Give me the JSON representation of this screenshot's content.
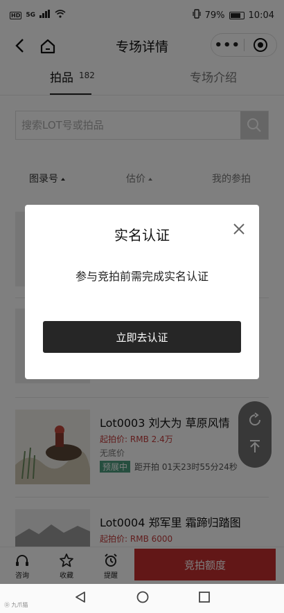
{
  "status_bar": {
    "network_badge": "HD",
    "network_type": "5G",
    "battery_percent": "79%",
    "time": "10:04"
  },
  "nav": {
    "title": "专场详情",
    "more_glyph": "•••"
  },
  "tabs": {
    "lots_label": "拍品",
    "lots_count": "182",
    "intro_label": "专场介绍"
  },
  "search": {
    "placeholder": "搜索LOT号或拍品"
  },
  "sort": {
    "catalog_label": "图录号",
    "estimate_label": "估价",
    "my_bids_label": "我的参拍"
  },
  "lots": [
    {
      "title": "Lot0003 刘大为 草原风情",
      "price_label": "起拍价:",
      "price_value": "RMB 2.4万",
      "reserve": "无底价",
      "status": "预展中",
      "countdown": "距开拍 01天23时55分24秒"
    },
    {
      "title": "Lot0004 郑军里 霜蹄归踏图",
      "price_label": "起拍价:",
      "price_value": "RMB 6000"
    }
  ],
  "bottom_bar": {
    "consult_label": "咨询",
    "favorite_label": "收藏",
    "remind_label": "提醒",
    "bid_quota_label": "竞拍额度"
  },
  "dialog": {
    "title": "实名认证",
    "message": "参与竞拍前需完成实名认证",
    "button_label": "立即去认证"
  },
  "system": {
    "watermark": "Ⓓ 九爪猫"
  }
}
